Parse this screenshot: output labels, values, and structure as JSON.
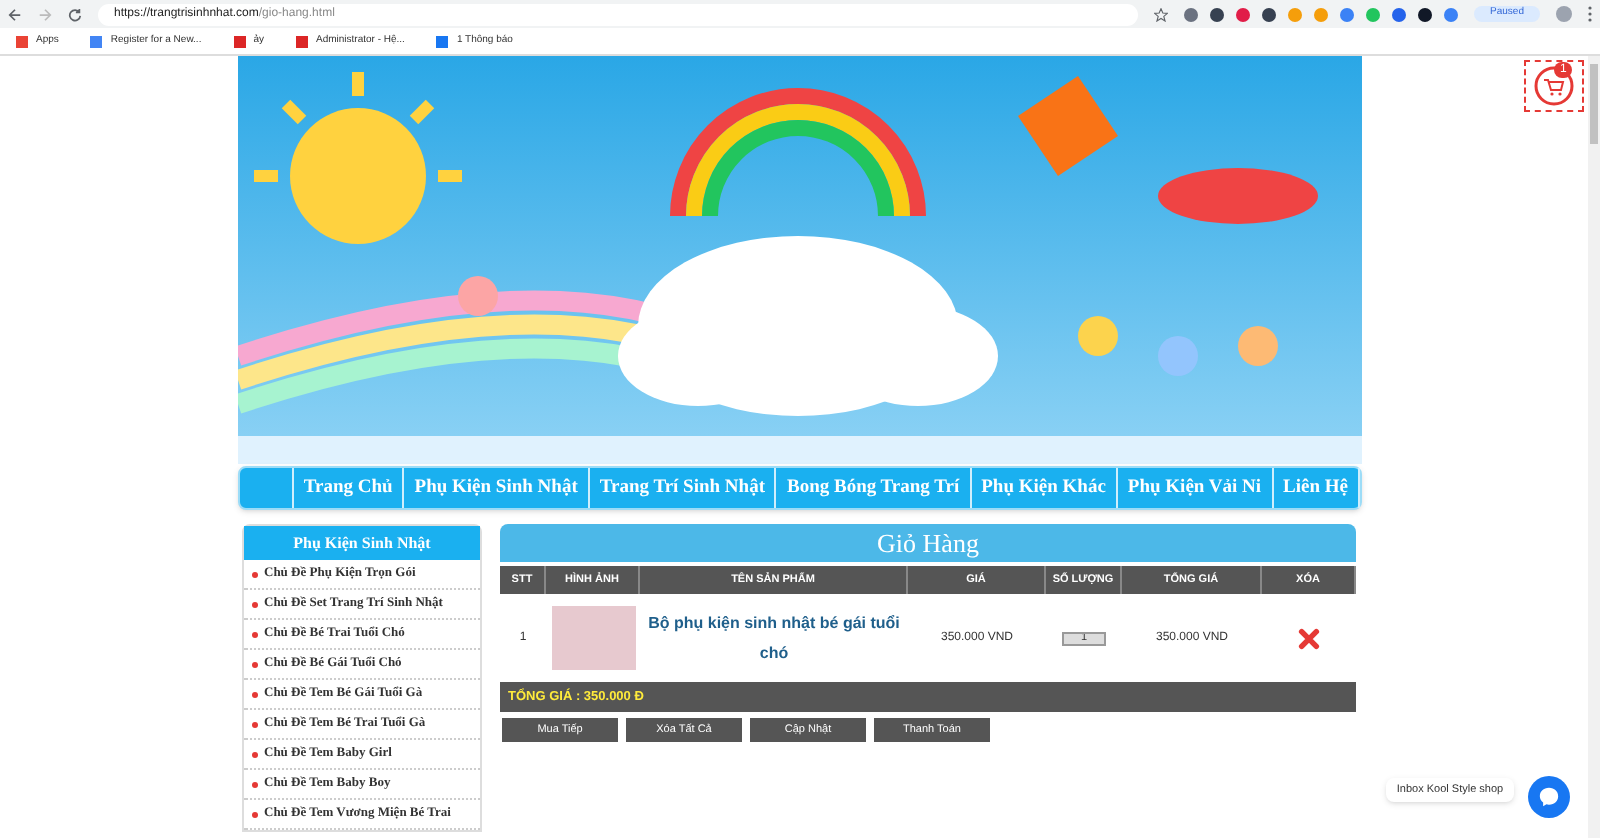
{
  "browser": {
    "url_host": "https://trangtrisinhnhat.com",
    "url_path": "/gio-hang.html",
    "bookmarks": [
      "Apps",
      "Register for a New...",
      "ảy",
      "Administrator - Hệ...",
      "1 Thông báo"
    ],
    "profile": "Paused"
  },
  "nav": {
    "items": [
      "Trang Chủ",
      "Phụ Kiện Sinh Nhật",
      "Trang Trí Sinh Nhật",
      "Bong Bóng Trang Trí",
      "Phụ Kiện Khác",
      "Phụ Kiện Vải Ni",
      "Liên Hệ"
    ]
  },
  "sidebar": {
    "title": "Phụ Kiện Sinh Nhật",
    "items": [
      "Chủ Đề Phụ Kiện Trọn Gói",
      "Chủ Đề Set Trang Trí Sinh Nhật",
      "Chủ Đề Bé Trai Tuổi Chó",
      "Chủ Đề Bé Gái Tuổi Chó",
      "Chủ Đề Tem Bé Gái Tuổi Gà",
      "Chủ Đề Tem Bé Trai Tuổi Gà",
      "Chủ Đề Tem Baby Girl",
      "Chủ Đề Tem Baby Boy",
      "Chủ Đề Tem Vương Miện Bé Trai"
    ]
  },
  "cart": {
    "title": "Giỏ Hàng",
    "columns": [
      "STT",
      "HÌNH ẢNH",
      "TÊN SẢN PHẨM",
      "GIÁ",
      "SỐ LƯỢNG",
      "TỔNG GIÁ",
      "XÓA"
    ],
    "rows": [
      {
        "stt": "1",
        "name": "Bộ phụ kiện sinh nhật bé gái tuổi chó",
        "price": "350.000 VND",
        "quantity": "1",
        "total": "350.000 VND"
      }
    ],
    "total": "TỔNG GIÁ : 350.000 Đ",
    "buttons": [
      "Mua Tiếp",
      "Xóa Tất Cả",
      "Cập Nhật",
      "Thanh Toán"
    ]
  },
  "cart_badge": "1",
  "chat_label": "Inbox Kool Style shop"
}
